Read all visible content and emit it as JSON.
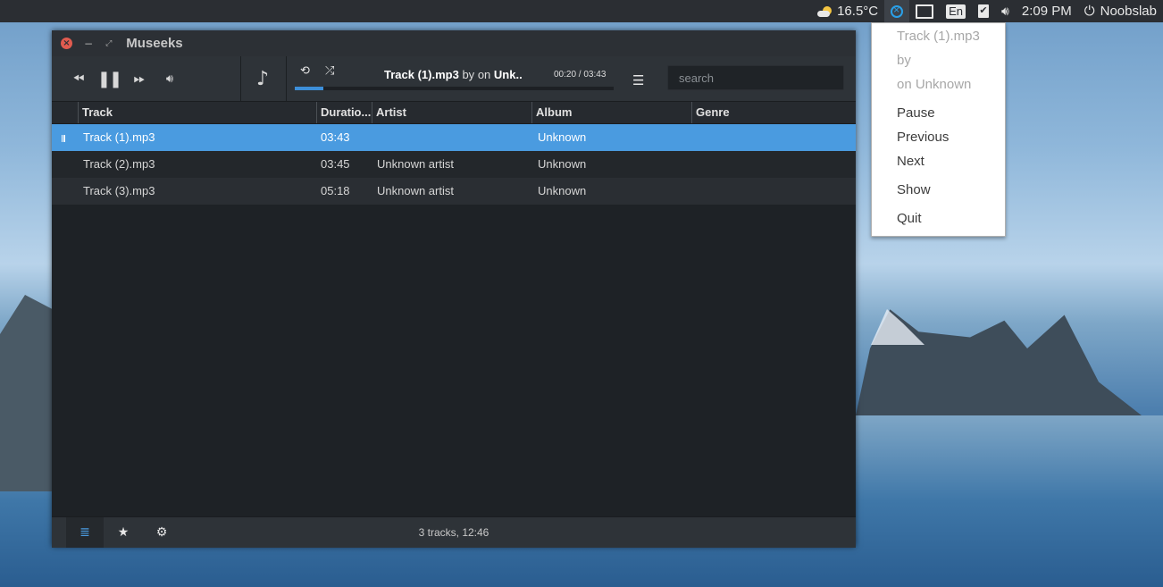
{
  "panel": {
    "temperature": "16.5°C",
    "language": "En",
    "time": "2:09 PM",
    "user": "Noobslab"
  },
  "tray_menu": {
    "track": "Track (1).mp3",
    "by": "by",
    "on": "on Unknown",
    "items": [
      "Pause",
      "Previous",
      "Next",
      "Show",
      "Quit"
    ]
  },
  "window": {
    "title": "Museeks"
  },
  "player": {
    "now_playing_title": "Track (1).mp3",
    "by_word": "by",
    "on_word": "on",
    "album_truncated": "Unk..",
    "time": "00:20 / 03:43",
    "progress_fraction": 0.09,
    "search_placeholder": "search"
  },
  "columns": [
    "Track",
    "Duratio...",
    "Artist",
    "Album",
    "Genre"
  ],
  "tracks": [
    {
      "track": "Track (1).mp3",
      "duration": "03:43",
      "artist": "",
      "album": "Unknown",
      "genre": ""
    },
    {
      "track": "Track (2).mp3",
      "duration": "03:45",
      "artist": "Unknown artist",
      "album": "Unknown",
      "genre": ""
    },
    {
      "track": "Track (3).mp3",
      "duration": "05:18",
      "artist": "Unknown artist",
      "album": "Unknown",
      "genre": ""
    }
  ],
  "footer": {
    "status": "3 tracks, 12:46"
  },
  "colors": {
    "accent": "#4a9be0",
    "close": "#e05b4f",
    "tray_icon": "#2aa0e8"
  },
  "icons": [
    "weather-icon",
    "museeks-tray-icon",
    "network-icon",
    "keyboard-layout-icon",
    "checklist-icon",
    "volume-icon",
    "power-icon",
    "previous-icon",
    "pause-icon",
    "next-icon",
    "volume-icon",
    "music-note-icon",
    "repeat-icon",
    "shuffle-icon",
    "queue-icon",
    "library-icon",
    "star-icon",
    "gear-icon"
  ]
}
